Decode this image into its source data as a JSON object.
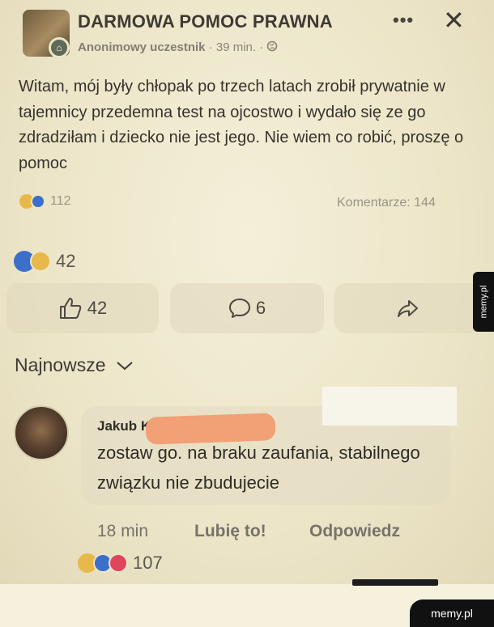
{
  "post": {
    "group_title": "DARMOWA POMOC PRAWNA",
    "author": "Anonimowy uczestnik",
    "time": "39 min.",
    "separator": "·",
    "text": "Witam, mój były chłopak po trzech latach zrobił prywatnie w tajemnicy przedemna test na ojcostwo i wydało się ze go zdradziłam i dziecko nie jest jego. Nie wiem co robić, proszę o pomoc",
    "reactions_count": "112",
    "comments_label": "Komentarze: 144",
    "more_icon": "more-dots-icon",
    "close_icon": "close-icon"
  },
  "engagement": {
    "reactions_count": "42",
    "like_count": "42",
    "comment_count": "6",
    "like_icon": "thumbs-up-icon",
    "comment_icon": "comment-bubble-icon",
    "share_icon": "share-arrow-icon"
  },
  "sort": {
    "label": "Najnowsze",
    "icon": "chevron-down-icon"
  },
  "comment": {
    "author": "Jakub K",
    "text": "zostaw go. na braku zaufania, stabilnego związku nie zbudujecie",
    "time": "18 min",
    "like_label": "Lubię to!",
    "reply_label": "Odpowiedz",
    "reactions_count": "107"
  },
  "watermarks": {
    "side": "memy.pl",
    "corner": "memy.pl"
  },
  "colors": {
    "like_blue": "#3b6fc9",
    "haha_yellow": "#e8b84a",
    "love_red": "#e0455e",
    "background": "#ece5c8"
  }
}
